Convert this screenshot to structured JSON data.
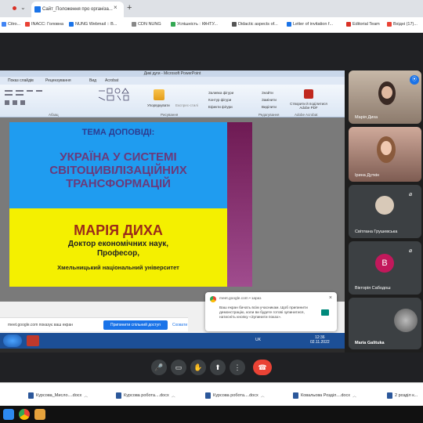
{
  "browser": {
    "tab_title": "Сайт_Положення про організа...",
    "tab_close": "×",
    "new_tab": "+",
    "tab_list": "⌄",
    "bookmarks": [
      {
        "label": "Citro...",
        "color": "#4285f4"
      },
      {
        "label": "INACC: Головна",
        "color": "#e94235"
      },
      {
        "label": "NUNG Webmail :: В...",
        "color": "#1a73e8"
      },
      {
        "label": "CDN NUNG",
        "color": "#888888"
      },
      {
        "label": "Успішність : ІФНТУ...",
        "color": "#34a853"
      },
      {
        "label": "Didactic aspects of...",
        "color": "#555555"
      },
      {
        "label": "Letter of invitation f...",
        "color": "#1a73e8"
      },
      {
        "label": "Editorial Team",
        "color": "#d93025"
      },
      {
        "label": "Вхідні (17)...",
        "color": "#ea4335"
      }
    ]
  },
  "ppt": {
    "title": "Дикі дуги - Microsoft PowerPoint",
    "tabs": [
      "Показ слайдів",
      "Рецензування",
      "Вид",
      "Acrobat"
    ],
    "ribbon_items": [
      "Упорядкувати",
      "Експрес-стилі",
      "Заливка фігури",
      "Контур фігури",
      "Ефекти фігури",
      "Знайти",
      "Замінити",
      "Виділити",
      "Створити й поділитися Adobe PDF"
    ],
    "groups": [
      "Абзац",
      "Рисування",
      "Редагування",
      "Adobe Acrobat"
    ]
  },
  "slide": {
    "topic_label": "ТЕМА ДОПОВІДІ:",
    "topic_line1": "УКРАЇНА У СИСТЕМІ",
    "topic_line2": "СВІТОЦИВІЛІЗАЦІЙНИХ",
    "topic_line3": "ТРАНСФОРМАЦІЙ",
    "speaker": "МАРІЯ ДИХА",
    "degree": "Доктор економічних наук,",
    "rank": "Професор,",
    "university": "Хмельницький  національний  університет"
  },
  "share_bar": {
    "text": "meet.google.com показує ваш екран",
    "stop_button": "Припинити спільний доступ",
    "hide_link": "Сховати"
  },
  "notification": {
    "source": "meet.google.com • зараз",
    "body": "Ваш екран бачать всім учасникам. Щоб припинити демонстрацію, коли ви будете готові зупинитися, натисніть кнопку «Зупинити показ».",
    "close": "×"
  },
  "win_taskbar": {
    "lang": "UK",
    "time": "12:36",
    "date": "02.11.2022"
  },
  "participants": [
    {
      "name": "Марія Диха"
    },
    {
      "name": "Ірина Дуткін"
    },
    {
      "name": "Світлана Грушевська"
    },
    {
      "name": "Вікторія Сабодош",
      "initial": "В"
    },
    {
      "name": "Maria Galituka"
    }
  ],
  "controls": {
    "mic": "🎤",
    "camera": "▭",
    "hand": "✋",
    "present": "⬆",
    "more": "⋮",
    "end": "☎"
  },
  "downloads": [
    {
      "label": "Курсова_Мисло....docx"
    },
    {
      "label": "Курсова робота....docx"
    },
    {
      "label": "Курсова робота....docx"
    },
    {
      "label": "Ковальова Розділ....docx"
    },
    {
      "label": "2 розділ к..."
    }
  ]
}
